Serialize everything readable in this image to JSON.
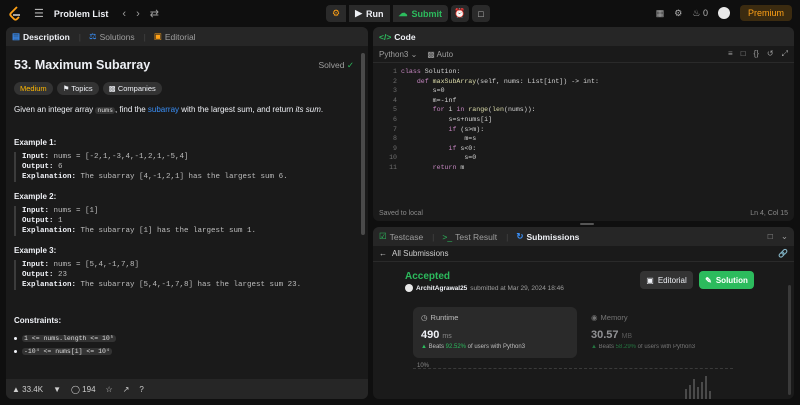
{
  "topbar": {
    "problem_list": "Problem List",
    "run": "Run",
    "submit": "Submit",
    "streak": "0",
    "premium": "Premium"
  },
  "left": {
    "tabs": [
      "Description",
      "Solutions",
      "Editorial"
    ],
    "title": "53. Maximum Subarray",
    "solved": "Solved",
    "tags": [
      "Medium",
      "Topics",
      "Companies"
    ],
    "statement": {
      "pre": "Given an integer array ",
      "code": "nums",
      "mid": ", find the ",
      "link": "subarray",
      "post": " with the largest sum, and return ",
      "em": "its sum",
      "end": "."
    },
    "examples": [
      {
        "title": "Example 1:",
        "input": "nums = [-2,1,-3,4,-1,2,1,-5,4]",
        "output": "6",
        "explanation": "The subarray [4,-1,2,1] has the largest sum 6."
      },
      {
        "title": "Example 2:",
        "input": "nums = [1]",
        "output": "1",
        "explanation": "The subarray [1] has the largest sum 1."
      },
      {
        "title": "Example 3:",
        "input": "nums = [5,4,-1,7,8]",
        "output": "23",
        "explanation": "The subarray [5,4,-1,7,8] has the largest sum 23."
      }
    ],
    "labels": {
      "input": "Input:",
      "output": "Output:",
      "explanation": "Explanation:"
    },
    "constraints_title": "Constraints:",
    "constraints": [
      "1 <= nums.length <= 10⁵",
      "-10⁴ <= nums[i] <= 10⁴"
    ],
    "likes": "33.4K",
    "comments": "194"
  },
  "code": {
    "tab": "Code",
    "language": "Python3",
    "auto": "Auto",
    "lines": [
      "class Solution:",
      "    def maxSubArray(self, nums: List[int]) -> int:",
      "        s=0",
      "        m=-inf",
      "        for i in range(len(nums)):",
      "            s=s+nums[i]",
      "            if (s>m):",
      "                m=s",
      "            if s<0:",
      "                s=0",
      "        return m"
    ],
    "saved": "Saved to local",
    "cursor": "Ln 4, Col 15"
  },
  "subs": {
    "tabs": [
      "Testcase",
      "Test Result",
      "Submissions"
    ],
    "back": "All Submissions",
    "status": "Accepted",
    "user": "ArchitAgrawal25",
    "submitted": "submitted at Mar 29, 2024 18:46",
    "editorial": "Editorial",
    "solution": "Solution",
    "runtime": {
      "label": "Runtime",
      "value": "490",
      "unit": "ms",
      "beats_pre": "Beats",
      "beats_pct": "92.52%",
      "beats_post": "of users with Python3"
    },
    "memory": {
      "label": "Memory",
      "value": "30.57",
      "unit": "MB",
      "beats_pre": "Beats",
      "beats_pct": "58.29%",
      "beats_post": "of users with Python3"
    },
    "chart_label": "10%"
  }
}
